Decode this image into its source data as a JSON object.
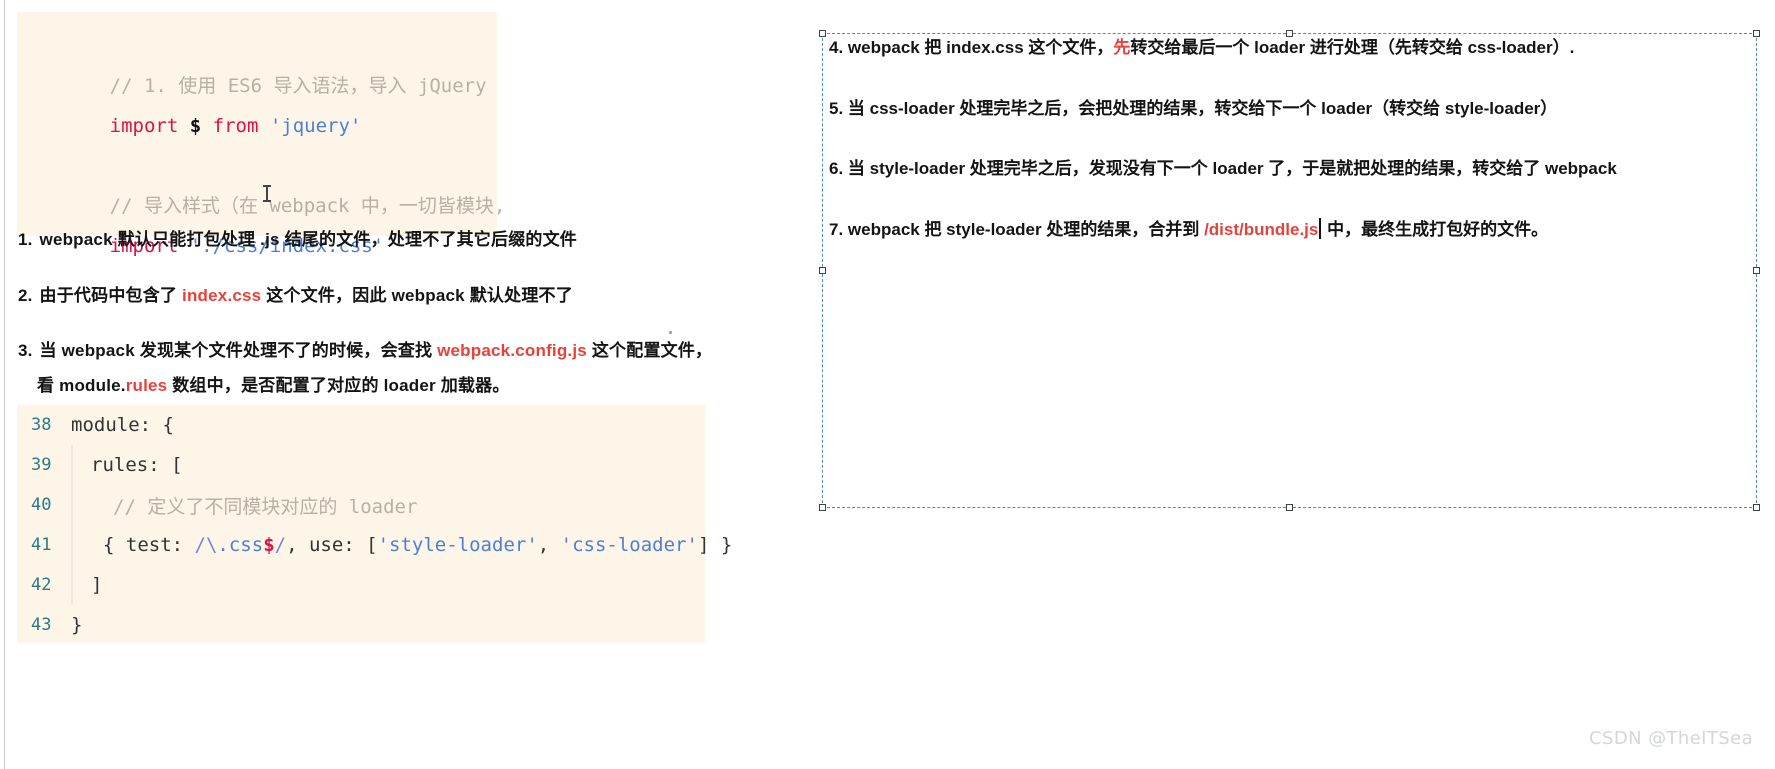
{
  "code_top": {
    "lines": [
      {
        "type": "comment",
        "text": "// 1. 使用 ES6 导入语法，导入 jQuery"
      },
      {
        "type": "import_jquery",
        "kw": "import",
        "var": "$",
        "from": "from",
        "str": "'jquery'"
      },
      {
        "type": "blank",
        "text": ""
      },
      {
        "type": "comment",
        "text": "// 导入样式（在 webpack 中，一切皆模块,"
      },
      {
        "type": "import_css",
        "kw": "import",
        "str": "'./css/index.css'"
      }
    ]
  },
  "notes": [
    {
      "index": "1.",
      "parts": [
        {
          "t": "webpack 默认只能打包处理 .js 结尾的文件，处理不了其它后缀的文件",
          "hl": false
        }
      ]
    },
    {
      "index": "2.",
      "parts": [
        {
          "t": "由于代码中包含了 ",
          "hl": false
        },
        {
          "t": "index.css",
          "hl": true
        },
        {
          "t": " 这个文件，因此 webpack 默认处理不了",
          "hl": false
        }
      ]
    },
    {
      "index": "3.",
      "parts": [
        {
          "t": "当 webpack 发现某个文件处理不了的时候，会查找 ",
          "hl": false
        },
        {
          "t": "webpack.config.js",
          "hl": true
        },
        {
          "t": " 这个配置文件，",
          "hl": false
        }
      ],
      "cont_parts": [
        {
          "t": "看 module.",
          "hl": false
        },
        {
          "t": "rules",
          "hl": true
        },
        {
          "t": " 数组中，是否配置了对应的 loader 加载器。",
          "hl": false
        }
      ]
    }
  ],
  "code_bottom": {
    "rows": [
      {
        "num": "38",
        "indent": 0,
        "code": "module: {"
      },
      {
        "num": "39",
        "indent": 1,
        "code": "rules: ["
      },
      {
        "num": "40",
        "indent": 2,
        "code": "// 定义了不同模块对应的 loader",
        "comment": true
      },
      {
        "num": "41",
        "indent": 2,
        "code": "{ test: /\\.css$/, use: ['style-loader', 'css-loader'] }",
        "rule": true
      },
      {
        "num": "42",
        "indent": 1,
        "code": "]"
      },
      {
        "num": "43",
        "indent": 0,
        "code": "}"
      }
    ],
    "rule_line": {
      "pre": "{ test: ",
      "regex_slash": "/",
      "regex_escape": "\\",
      "regex_dot": ".css",
      "regex_dollar": "$",
      "regex_slash2": "/",
      "mid": ", use: [",
      "str1": "'style-loader'",
      "comma": ", ",
      "str2": "'css-loader'",
      "post": "] }"
    }
  },
  "selection": {
    "notes": [
      {
        "index": "4.",
        "parts": [
          {
            "t": "webpack 把 index.css 这个文件，",
            "hl": false
          },
          {
            "t": "先",
            "hl": true
          },
          {
            "t": "转交给最后一个 loader 进行处理（先转交给 css-loader）.",
            "hl": false
          }
        ]
      },
      {
        "index": "5.",
        "parts": [
          {
            "t": "当 css-loader 处理完毕之后，会把处理的结果，转交给下一个 loader（转交给 style-loader）",
            "hl": false
          }
        ]
      },
      {
        "index": "6.",
        "parts": [
          {
            "t": "当 style-loader 处理完毕之后，发现没有下一个 loader 了，于是就把处理的结果，转交给了 webpack",
            "hl": false
          }
        ]
      },
      {
        "index": "7.",
        "parts": [
          {
            "t": "webpack 把 style-loader 处理的结果，合并到 ",
            "hl": false
          },
          {
            "t": "/dist/bundle.js",
            "hl": true
          },
          {
            "t": "CARET",
            "hl": false
          },
          {
            "t": " 中，最终生成打包好的文件。",
            "hl": false
          }
        ]
      }
    ]
  },
  "watermark": {
    "text": "CSDN @TheITSea"
  },
  "colors": {
    "code_background": "#fdf6e8",
    "highlight_red": "#e8413a",
    "keyword_red": "#d14",
    "string_blue": "#4c7fd4",
    "comment_gray": "#b7b0a3",
    "gutter_teal": "#2c7a84",
    "selection_dashed": "#4f8fa0",
    "watermark_gray": "#d3d6da"
  }
}
